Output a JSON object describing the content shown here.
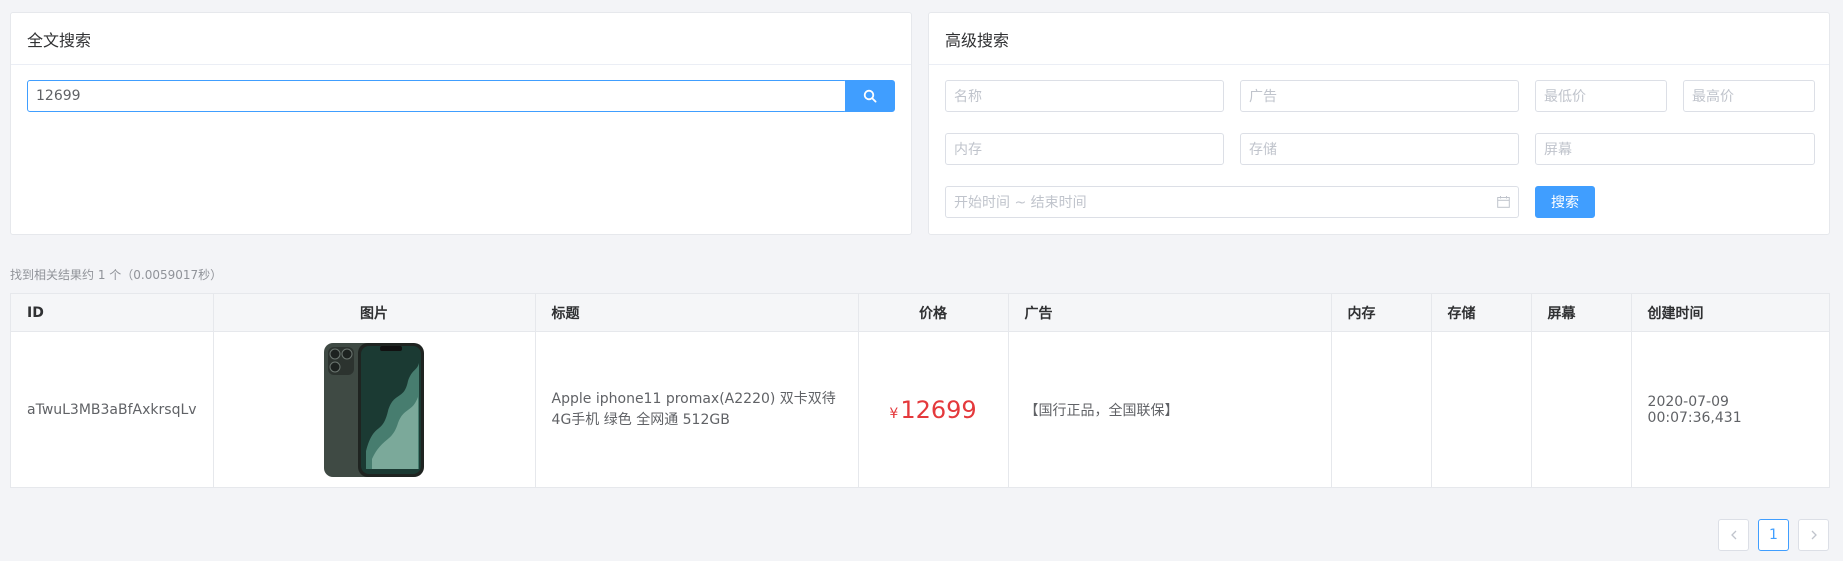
{
  "fulltext": {
    "title": "全文搜索",
    "query": "12699",
    "search_icon": "search-icon"
  },
  "advanced": {
    "title": "高级搜索",
    "name_placeholder": "名称",
    "ad_placeholder": "广告",
    "min_price_placeholder": "最低价",
    "max_price_placeholder": "最高价",
    "memory_placeholder": "内存",
    "storage_placeholder": "存储",
    "screen_placeholder": "屏幕",
    "date_range_placeholder": "开始时间 ~ 结束时间",
    "calendar_icon": "calendar-icon",
    "search_button": "搜索"
  },
  "summary": "找到相关结果约 1 个（0.0059017秒）",
  "table": {
    "headers": {
      "id": "ID",
      "image": "图片",
      "title": "标题",
      "price": "价格",
      "ad": "广告",
      "memory": "内存",
      "storage": "存储",
      "screen": "屏幕",
      "created": "创建时间"
    },
    "rows": [
      {
        "id": "aTwuL3MB3aBfAxkrsqLv",
        "image": "phone-image",
        "title": "Apple iphone11 promax(A2220) 双卡双待4G手机 绿色 全网通 512GB",
        "price_symbol": "¥",
        "price": "12699",
        "ad": "【国行正品，全国联保】",
        "memory": "",
        "storage": "",
        "screen": "",
        "created": "2020-07-09 00:07:36,431"
      }
    ]
  },
  "pagination": {
    "prev_icon": "chevron-left-icon",
    "current": "1",
    "next_icon": "chevron-right-icon"
  },
  "colors": {
    "primary": "#409eff",
    "price": "#e4393c"
  }
}
